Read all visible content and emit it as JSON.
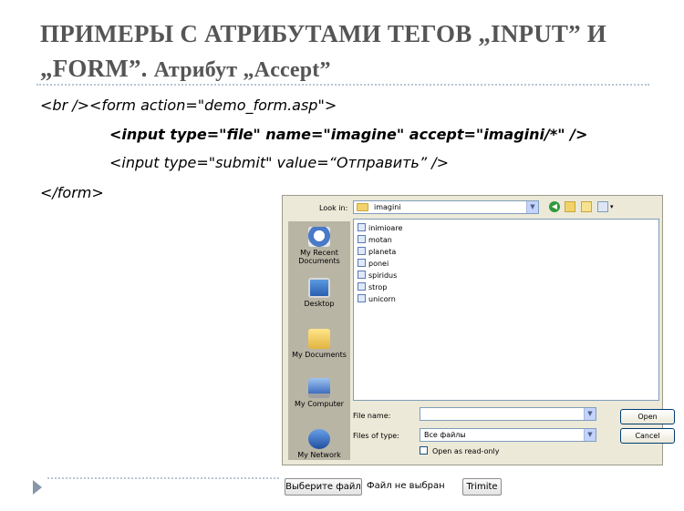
{
  "slide": {
    "title_line1": "ПРИМЕРЫ С АТРИБУТАМИ ТЕГОВ „INPUT” И",
    "title_line2_a": "„FORM”.",
    "title_line2_b": "Атрибут „Accept”"
  },
  "code": {
    "line1": "<br /><form action=\"demo_form.asp\">",
    "line2": "<input type=\"file\" name=\"imagine\" accept=\"imagini/*\" />",
    "line3": "<input type=\"submit\" value=“Отправить” />",
    "line4": "</form>"
  },
  "dialog": {
    "look_in_label": "Look in:",
    "look_in_value": "imagini",
    "places": [
      {
        "label": "My Recent Documents",
        "icon": "recent-documents-icon"
      },
      {
        "label": "Desktop",
        "icon": "desktop-icon"
      },
      {
        "label": "My Documents",
        "icon": "my-documents-icon"
      },
      {
        "label": "My Computer",
        "icon": "my-computer-icon"
      },
      {
        "label": "My Network",
        "icon": "my-network-icon"
      }
    ],
    "files": [
      "inimioare",
      "motan",
      "planeta",
      "ponei",
      "spiridus",
      "strop",
      "unicorn"
    ],
    "file_name_label": "File name:",
    "file_name_value": "",
    "files_of_type_label": "Files of type:",
    "files_of_type_value": "Все файлы",
    "read_only_label": "Open as read-only",
    "open_label": "Open",
    "cancel_label": "Cancel"
  },
  "file_input": {
    "choose_label": "Выберите файл",
    "no_file_label": "Файл не выбран",
    "submit_label": "Trimite"
  },
  "colors": {
    "title": "#555555",
    "dialog_bg": "#ece9d8",
    "places_bar": "#b9b5a5",
    "rule": "#b9c6d6"
  }
}
